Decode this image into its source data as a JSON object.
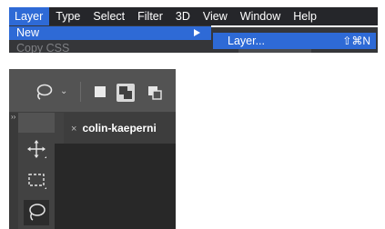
{
  "menubar": {
    "items": [
      "Layer",
      "Type",
      "Select",
      "Filter",
      "3D",
      "View",
      "Window",
      "Help"
    ],
    "active_item": "Layer"
  },
  "layer_menu": {
    "item_new": "New",
    "item_copy_css": "Copy CSS"
  },
  "new_submenu": {
    "item_layer": "Layer...",
    "item_layer_shortcut": "⇧⌘N"
  },
  "options_bar": {
    "tool_icon": "lasso-icon",
    "selection_modes": [
      "new-selection-icon",
      "add-to-selection-icon",
      "subtract-from-selection-icon"
    ]
  },
  "tools": {
    "items": [
      "move-icon",
      "marquee-icon",
      "lasso-icon"
    ],
    "active": "lasso-icon"
  },
  "document_tab": {
    "close_glyph": "×",
    "title": "colin-kaeperni"
  },
  "colors": {
    "menubar_bg": "#25262a",
    "menu_bg": "#353639",
    "highlight": "#2e6ad6",
    "panel_bg": "#535353",
    "canvas_bg": "#282828"
  }
}
